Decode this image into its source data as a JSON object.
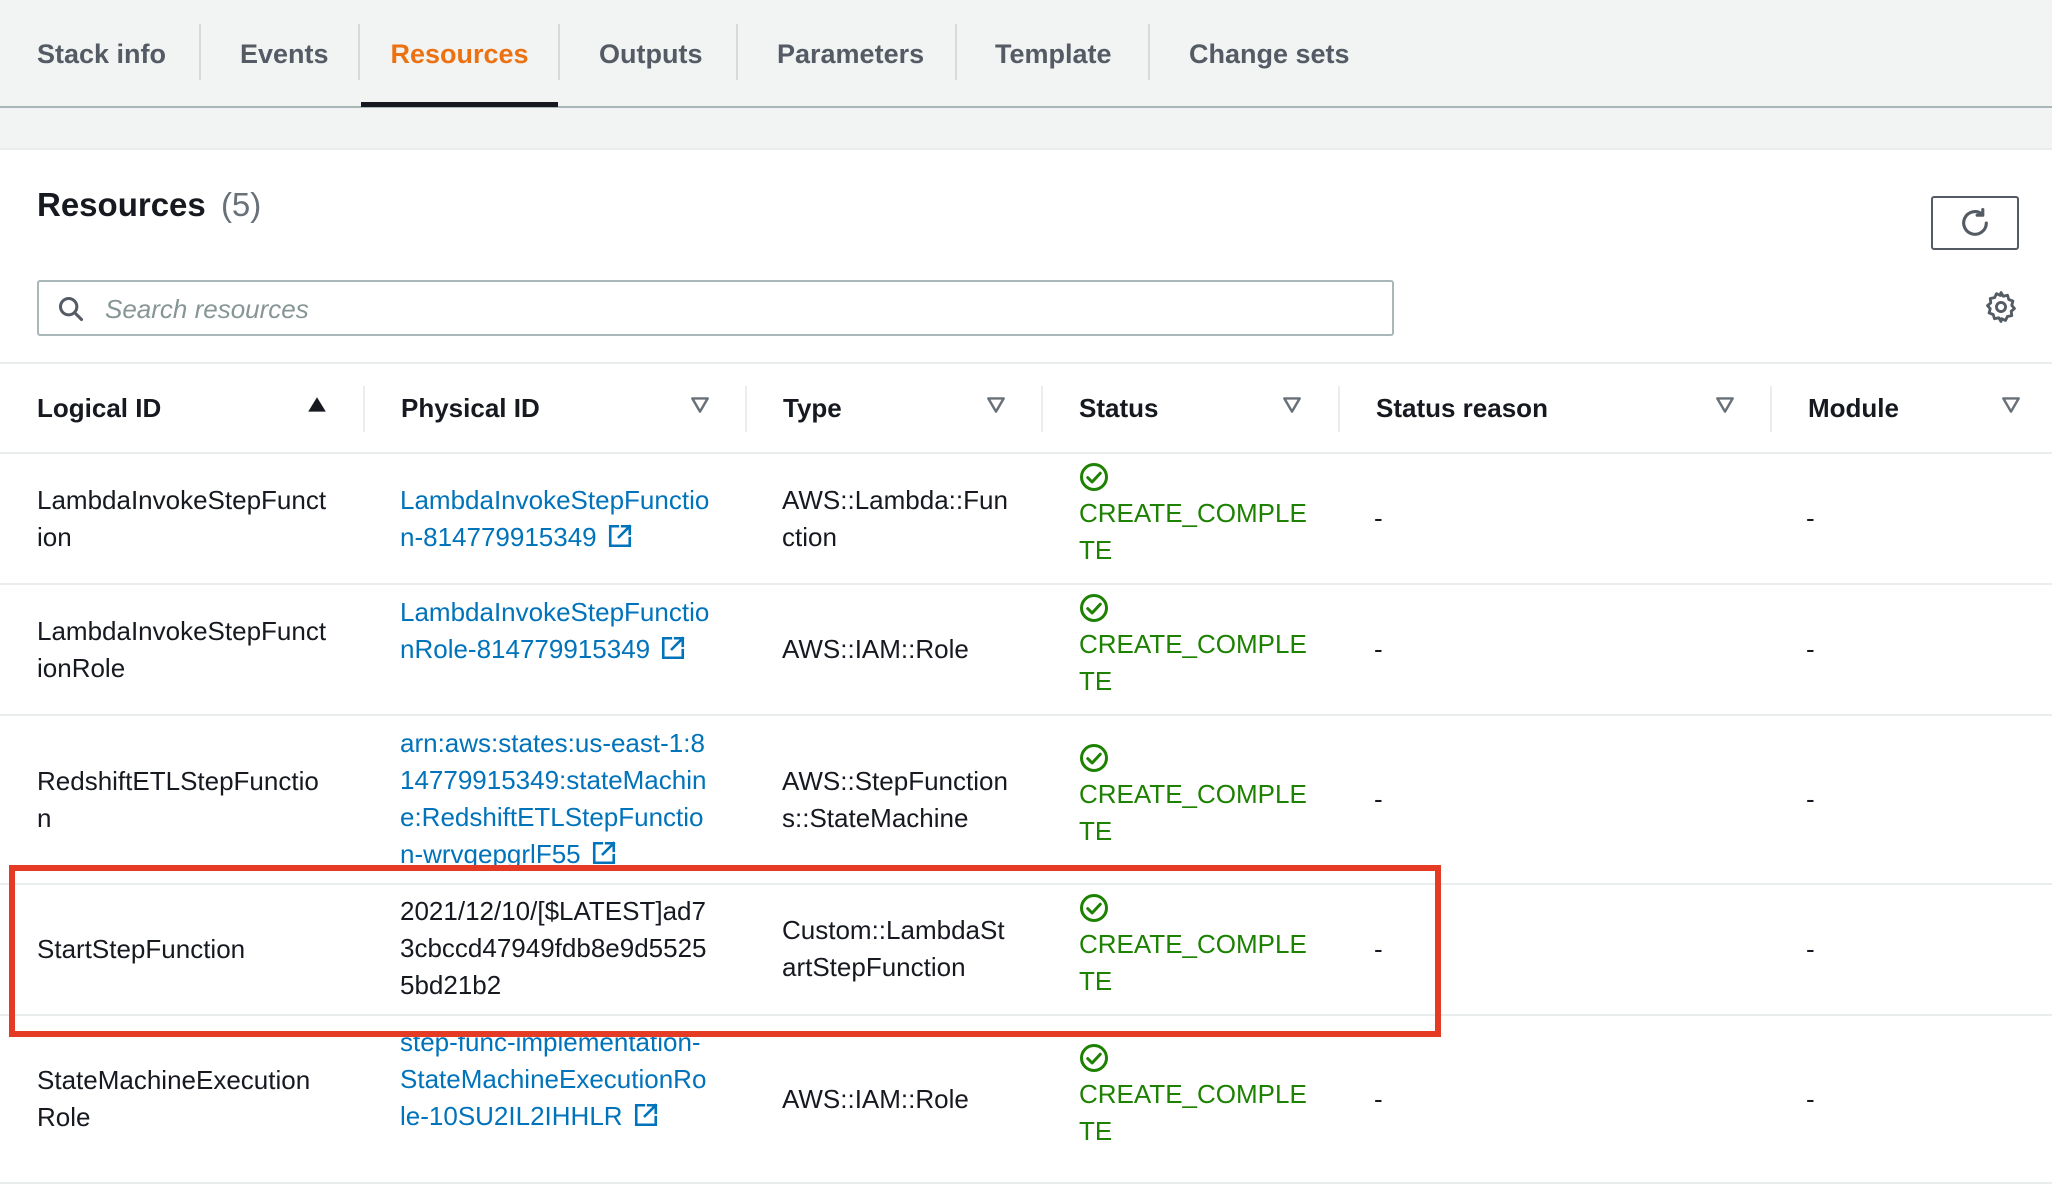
{
  "tabs": [
    {
      "label": "Stack info"
    },
    {
      "label": "Events"
    },
    {
      "label": "Resources",
      "active": true
    },
    {
      "label": "Outputs"
    },
    {
      "label": "Parameters"
    },
    {
      "label": "Template"
    },
    {
      "label": "Change sets"
    }
  ],
  "panel": {
    "title": "Resources",
    "count": "(5)"
  },
  "search": {
    "placeholder": "Search resources",
    "value": ""
  },
  "table": {
    "headers": [
      {
        "label": "Logical ID",
        "sort": "ascending"
      },
      {
        "label": "Physical ID",
        "sort": "none"
      },
      {
        "label": "Type",
        "sort": "none"
      },
      {
        "label": "Status",
        "sort": "none"
      },
      {
        "label": "Status reason",
        "sort": "none"
      },
      {
        "label": "Module",
        "sort": "none"
      }
    ],
    "rows": [
      {
        "logical_id": "LambdaInvokeStepFunction",
        "physical_id": "LambdaInvokeStepFunction-814779915349",
        "physical_is_link": true,
        "type": "AWS::Lambda::Function",
        "status": "CREATE_COMPLETE",
        "status_reason": "-",
        "module": "-"
      },
      {
        "logical_id": "LambdaInvokeStepFunctionRole",
        "physical_id": "LambdaInvokeStepFunctionRole-814779915349",
        "physical_is_link": true,
        "type": "AWS::IAM::Role",
        "status": "CREATE_COMPLETE",
        "status_reason": "-",
        "module": "-"
      },
      {
        "logical_id": "RedshiftETLStepFunction",
        "physical_id": "arn:aws:states:us-east-1:814779915349:stateMachine:RedshiftETLStepFunction-wrvqepgrlF55",
        "physical_is_link": true,
        "type": "AWS::StepFunctions::StateMachine",
        "status": "CREATE_COMPLETE",
        "status_reason": "-",
        "module": "-",
        "highlighted": true
      },
      {
        "logical_id": "StartStepFunction",
        "physical_id": "2021/12/10/[$LATEST]ad73cbccd47949fdb8e9d55255bd21b2",
        "physical_is_link": false,
        "type": "Custom::LambdaStartStepFunction",
        "status": "CREATE_COMPLETE",
        "status_reason": "-",
        "module": "-"
      },
      {
        "logical_id": "StateMachineExecutionRole",
        "physical_id": "step-func-implementation-StateMachineExecutionRole-10SU2IL2IHHLR",
        "physical_is_link": true,
        "type": "AWS::IAM::Role",
        "status": "CREATE_COMPLETE",
        "status_reason": "-",
        "module": "-"
      }
    ]
  },
  "colors": {
    "accent": "#ec7211",
    "link": "#0073bb",
    "success": "#1d8102",
    "highlight": "#e53b24"
  },
  "icons": {
    "refresh": "refresh-icon",
    "search": "search-icon",
    "settings": "gear-icon",
    "external_link": "external-link-icon",
    "status_success": "check-circle-icon"
  }
}
